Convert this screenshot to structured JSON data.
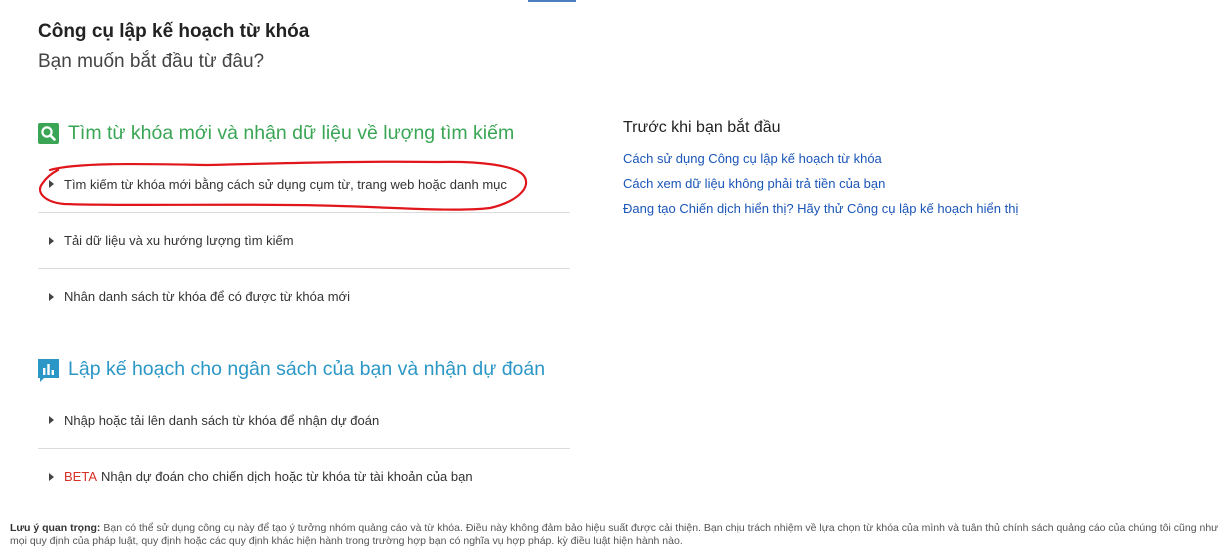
{
  "header": {
    "title": "Công cụ lập kế hoạch từ khóa",
    "subtitle": "Bạn muốn bắt đầu từ đâu?"
  },
  "find_section": {
    "icon": "search-icon",
    "title": "Tìm từ khóa mới và nhận dữ liệu về lượng tìm kiếm",
    "items": [
      {
        "label": "Tìm kiếm từ khóa mới bằng cách sử dụng cụm từ, trang web hoặc danh mục"
      },
      {
        "label": "Tải dữ liệu và xu hướng lượng tìm kiếm"
      },
      {
        "label": "Nhân danh sách từ khóa để có được từ khóa mới"
      }
    ]
  },
  "plan_section": {
    "icon": "bar-chart-icon",
    "title": "Lập kế hoạch cho ngân sách của bạn và nhận dự đoán",
    "items": [
      {
        "label": "Nhập hoặc tải lên danh sách từ khóa để nhận dự đoán"
      },
      {
        "badge": "BETA",
        "label": "Nhận dự đoán cho chiến dịch hoặc từ khóa từ tài khoản của bạn"
      }
    ]
  },
  "side_panel": {
    "heading": "Trước khi bạn bắt đầu",
    "links": [
      "Cách sử dụng Công cụ lập kế hoạch từ khóa",
      "Cách xem dữ liệu không phải trả tiền của bạn",
      "Đang tạo Chiến dịch hiển thị? Hãy thử Công cụ lập kế hoạch hiển thị"
    ]
  },
  "footer": {
    "label": "Lưu ý quan trọng:",
    "text": "Bạn có thể sử dụng công cụ này để tạo ý tưởng nhóm quảng cáo và từ khóa. Điều này không đảm bảo hiệu suất được cải thiện. Bạn chịu trách nhiệm về lựa chọn từ khóa của mình và tuân thủ chính sách quảng cáo của chúng tôi cũng như mọi quy định của pháp luật, quy định hoặc các quy định khác hiện hành trong trường hợp bạn có nghĩa vụ hợp pháp. kỳ điều luật hiện hành nào."
  },
  "colors": {
    "find_green": "#3aa655",
    "plan_blue": "#2a97c6",
    "link_blue": "#1a55b8",
    "annotation_red": "#e0161b",
    "beta_red": "#d93025"
  }
}
